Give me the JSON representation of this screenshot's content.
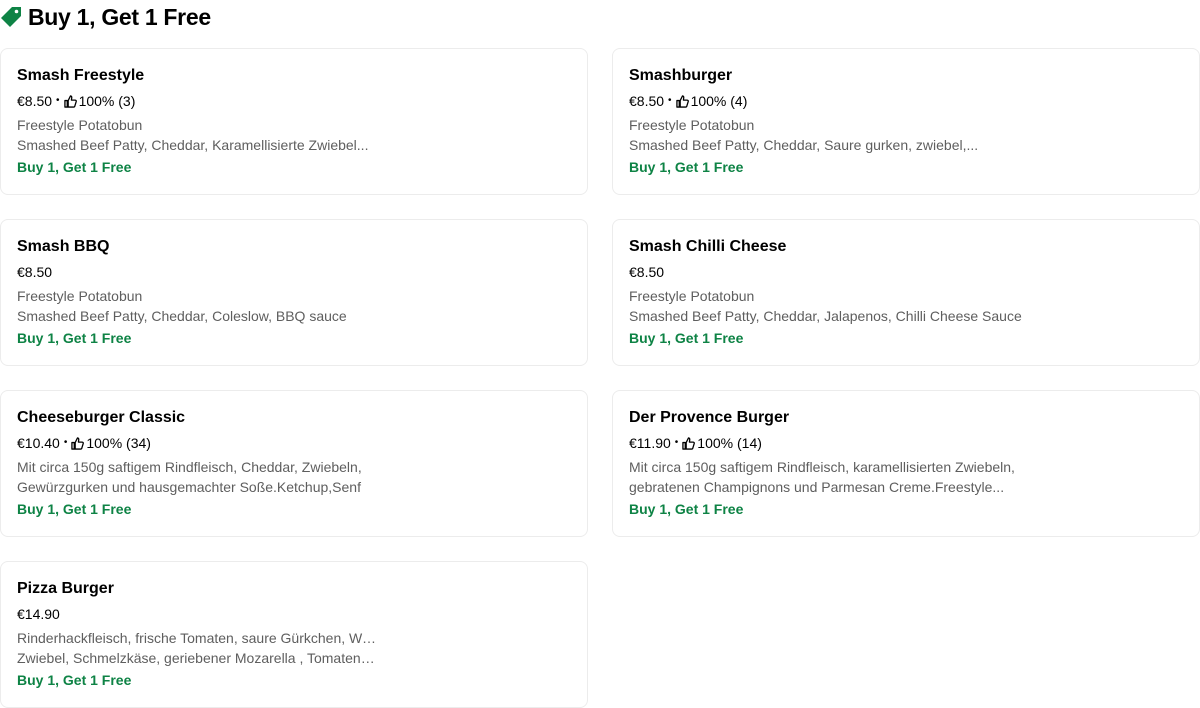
{
  "section": {
    "title": "Buy 1, Get 1 Free",
    "icon": "price-tag-icon",
    "accent_color": "#0e8345"
  },
  "items": [
    {
      "name": "Smash Freestyle",
      "price": "€8.50",
      "rating": "100%",
      "reviews": "(3)",
      "desc_line1": "Freestyle Potatobun",
      "desc_line2": "Smashed Beef Patty, Cheddar, Karamellisierte Zwiebel...",
      "promo": "Buy 1, Get 1 Free"
    },
    {
      "name": "Smashburger",
      "price": "€8.50",
      "rating": "100%",
      "reviews": "(4)",
      "desc_line1": "Freestyle Potatobun",
      "desc_line2": "Smashed Beef Patty, Cheddar, Saure gurken, zwiebel,...",
      "promo": "Buy 1, Get 1 Free"
    },
    {
      "name": "Smash BBQ",
      "price": "€8.50",
      "desc_line1": "Freestyle Potatobun",
      "desc_line2": "Smashed Beef Patty, Cheddar, Coleslow, BBQ sauce",
      "promo": "Buy 1, Get 1 Free"
    },
    {
      "name": "Smash Chilli Cheese",
      "price": "€8.50",
      "desc_line1": "Freestyle Potatobun",
      "desc_line2": "Smashed Beef Patty, Cheddar, Jalapenos, Chilli Cheese Sauce",
      "promo": "Buy 1, Get 1 Free"
    },
    {
      "name": "Cheeseburger Classic",
      "price": "€10.40",
      "rating": "100%",
      "reviews": "(34)",
      "desc_line1": "Mit circa 150g saftigem Rindfleisch, Cheddar, Zwiebeln,",
      "desc_line2": "Gewürzgurken und hausgemachter Soße.Ketchup,Senf",
      "promo": "Buy 1, Get 1 Free"
    },
    {
      "name": "Der Provence Burger",
      "price": "€11.90",
      "rating": "100%",
      "reviews": "(14)",
      "desc_line1": "Mit circa 150g saftigem Rindfleisch, karamellisierten Zwiebeln,",
      "desc_line2": "gebratenen Champignons und Parmesan Creme.Freestyle...",
      "promo": "Buy 1, Get 1 Free"
    },
    {
      "name": "Pizza Burger",
      "price": "€14.90",
      "desc_line1": "Rinderhackfleisch, frische Tomaten, saure Gürkchen, Weiße",
      "desc_line2": "Zwiebel, Schmelzkäse, geriebener Mozarella , Tomatensauce...",
      "promo": "Buy 1, Get 1 Free"
    }
  ]
}
